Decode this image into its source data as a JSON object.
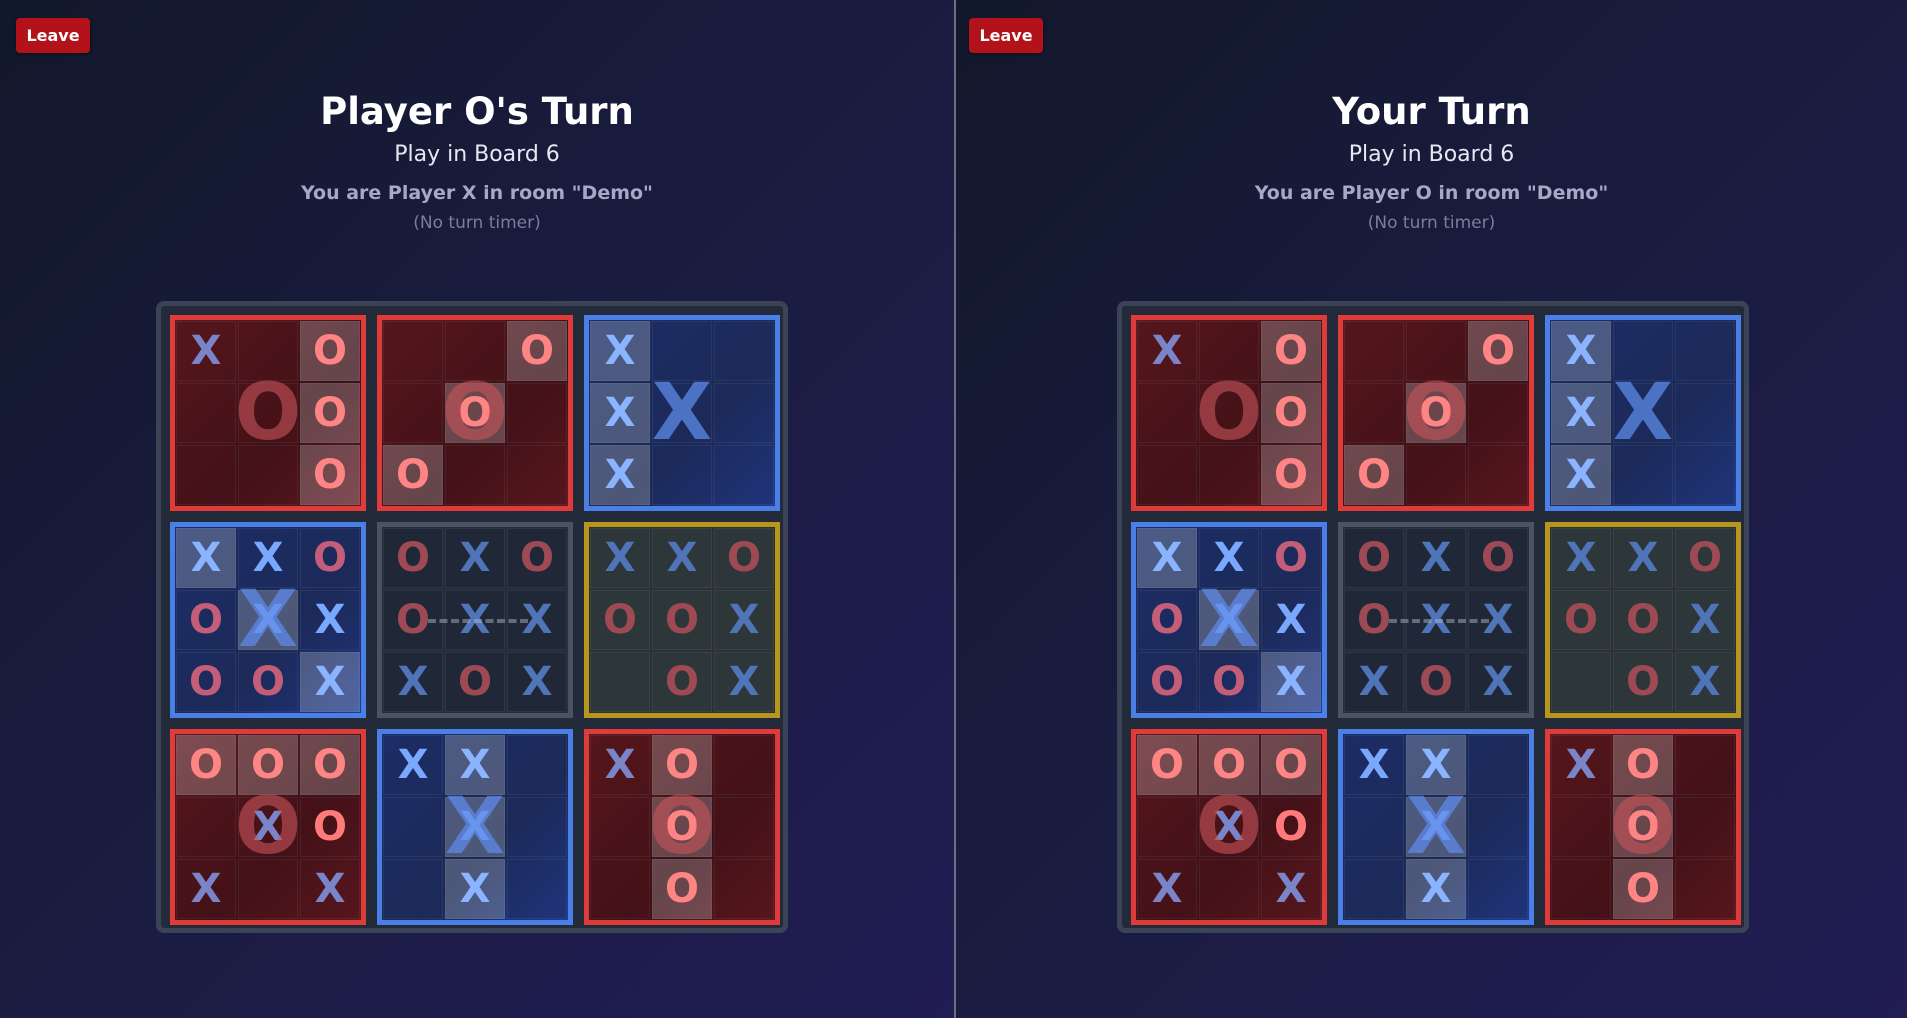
{
  "leave_label": "Leave",
  "players": [
    {
      "turn_title": "Player O's Turn",
      "board_hint": "Play in Board 6",
      "role_line": "You are Player X in room \"Demo\"",
      "timer_line": "(No turn timer)"
    },
    {
      "turn_title": "Your Turn",
      "board_hint": "Play in Board 6",
      "role_line": "You are Player O in room \"Demo\"",
      "timer_line": "(No turn timer)"
    }
  ],
  "colors": {
    "X": "#4a7fe8",
    "O": "#e03b3b",
    "tie": "#b8961d",
    "leave": "#b3121a"
  },
  "board": [
    {
      "owner": "O",
      "cells": [
        "X",
        "",
        "O",
        "",
        "",
        "O",
        "",
        "",
        "O"
      ],
      "highlight": [
        2,
        5,
        8
      ]
    },
    {
      "owner": "O",
      "cells": [
        "",
        "",
        "O",
        "",
        "O",
        "",
        "O",
        "",
        ""
      ],
      "highlight": [
        2,
        4,
        6
      ]
    },
    {
      "owner": "X",
      "cells": [
        "X",
        "",
        "",
        "X",
        "",
        "",
        "X",
        "",
        ""
      ],
      "highlight": [
        0,
        3,
        6
      ]
    },
    {
      "owner": "X",
      "cells": [
        "X",
        "X",
        "O",
        "O",
        "X",
        "X",
        "O",
        "O",
        "X"
      ],
      "highlight": [
        0,
        4,
        8
      ]
    },
    {
      "owner": "none",
      "cells": [
        "O",
        "X",
        "O",
        "O",
        "X",
        "X",
        "X",
        "O",
        "X"
      ],
      "highlight": []
    },
    {
      "owner": "tie",
      "cells": [
        "X",
        "X",
        "O",
        "O",
        "O",
        "X",
        "",
        "O",
        "X"
      ],
      "highlight": []
    },
    {
      "owner": "O",
      "cells": [
        "O",
        "O",
        "O",
        "",
        "X",
        "O",
        "X",
        "",
        "X"
      ],
      "highlight": [
        0,
        1,
        2
      ]
    },
    {
      "owner": "X",
      "cells": [
        "X",
        "X",
        "",
        "",
        "X",
        "",
        "",
        "X",
        ""
      ],
      "highlight": [
        1,
        4,
        7
      ]
    },
    {
      "owner": "O",
      "cells": [
        "X",
        "O",
        "",
        "",
        "O",
        "",
        "",
        "O",
        ""
      ],
      "highlight": [
        1,
        4,
        7
      ]
    }
  ]
}
